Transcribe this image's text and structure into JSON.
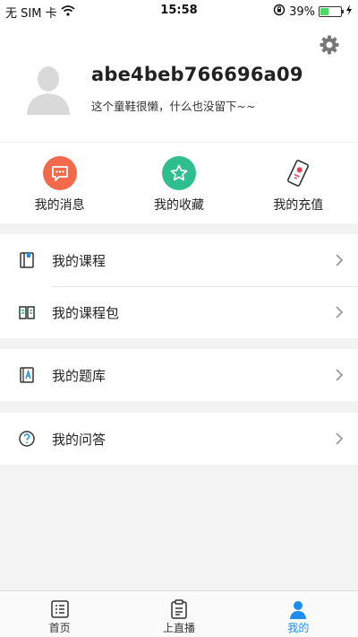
{
  "status_bar": {
    "carrier": "无 SIM 卡",
    "time": "15:58",
    "battery": "39%",
    "battery_level": 0.39
  },
  "profile": {
    "username": "abe4beb766696a09",
    "signature": "这个童鞋很懒，什么也没留下~~",
    "settings_icon": "gear-icon"
  },
  "quick_actions": [
    {
      "label": "我的消息",
      "icon": "message-icon",
      "color": "#f26a4b"
    },
    {
      "label": "我的收藏",
      "icon": "star-icon",
      "color": "#2fbf8f"
    },
    {
      "label": "我的充值",
      "icon": "recharge-ticket-icon",
      "color": "#e0455a"
    }
  ],
  "menu": {
    "courses": "我的课程",
    "course_packages": "我的课程包",
    "question_bank": "我的题库",
    "qa": "我的问答"
  },
  "tabbar": {
    "items": [
      {
        "label": "首页",
        "icon": "list-icon"
      },
      {
        "label": "上直播",
        "icon": "clipboard-icon"
      },
      {
        "label": "我的",
        "icon": "person-icon"
      }
    ],
    "active_color": "#1d8ef0"
  }
}
